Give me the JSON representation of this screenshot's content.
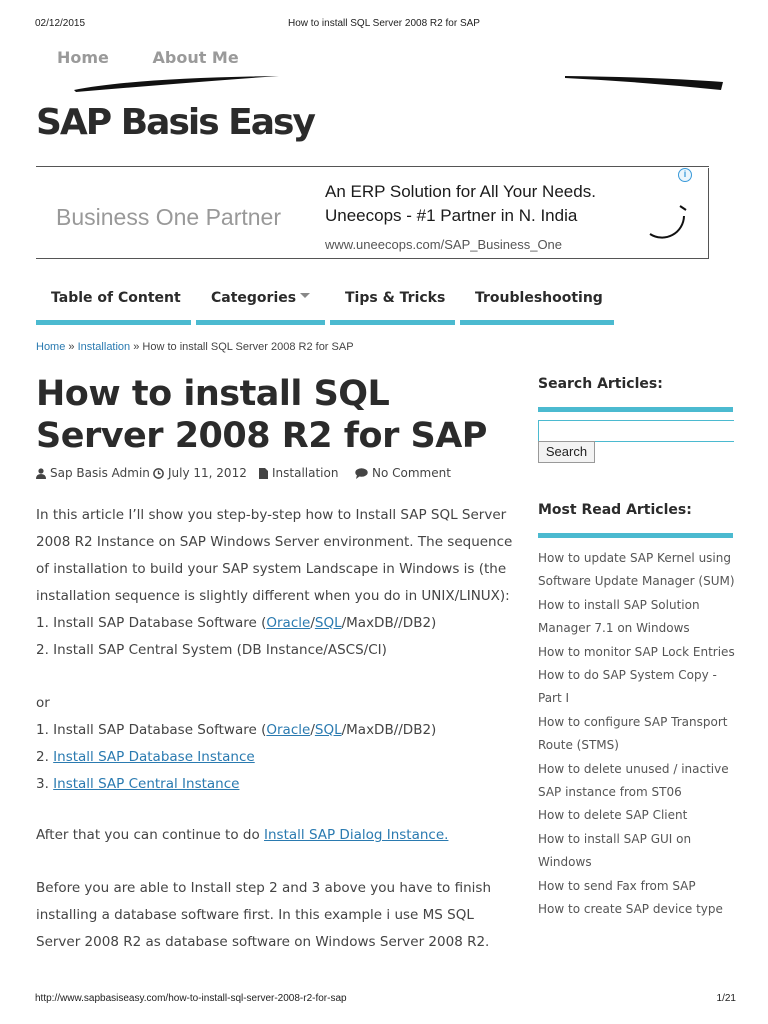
{
  "print": {
    "date": "02/12/2015",
    "doc_title": "How to install SQL Server 2008 R2 for SAP",
    "footer_url": "http://www.sapbasiseasy.com/how-to-install-sql-server-2008-r2-for-sap",
    "page": "1/21"
  },
  "topnav": {
    "home": "Home",
    "about": "About Me"
  },
  "site": {
    "title": "SAP Basis Easy"
  },
  "ad": {
    "brand": "Business One Partner",
    "headline_1": "An ERP Solution for All Your Needs.",
    "headline_2": "Uneecops - #1 Partner in N. India",
    "url": "www.uneecops.com/SAP_Business_One",
    "info_icon": "i"
  },
  "catnav": {
    "items": [
      "Table of Content",
      "Categories",
      "Tips & Tricks",
      "Troubleshooting"
    ]
  },
  "breadcrumb": {
    "home": "Home",
    "sep": " » ",
    "category": "Installation",
    "current": "How to install SQL Server 2008 R2 for SAP"
  },
  "article": {
    "title": "How to install SQL Server 2008 R2 for SAP",
    "author": "Sap Basis Admin",
    "date": "July 11, 2012",
    "category": "Installation",
    "comments": "No Comment",
    "intro_lines": [
      "In this article I’ll show you step-by-step how to Install SAP SQL Server",
      "2008 R2 Instance on SAP Windows Server environment. The sequence",
      "of installation to build your SAP system Landscape in Windows is (the",
      "installation sequence is slightly different when you do in UNIX/LINUX):"
    ],
    "step1a_prefix": "1. Install SAP Database Software (",
    "link_oracle": "Oracle",
    "slash": "/",
    "link_sql": "SQL",
    "step1a_suffix": "/MaxDB//DB2)",
    "step2a": "2. Install SAP Central System (DB Instance/ASCS/CI)",
    "or": "or",
    "step2b_prefix": "2. ",
    "step2b_link": "Install SAP Database Instance",
    "step3b_prefix": "3. ",
    "step3b_link": "Install SAP Central Instance",
    "after_prefix": "After that you can continue to do ",
    "after_link": "Install SAP Dialog Instance.",
    "before_lines": [
      "Before you are able to Install step 2 and 3 above you have to finish",
      "installing a database software first. In this example i use MS SQL",
      "Server 2008 R2 as database software on Windows Server 2008 R2."
    ]
  },
  "sidebar": {
    "search_heading": "Search Articles:",
    "search_button": "Search",
    "most_read_heading": "Most Read Articles:",
    "most_read": [
      [
        "How to update SAP Kernel using",
        "Software Update Manager (SUM)"
      ],
      [
        "How to install SAP Solution",
        "Manager 7.1 on Windows"
      ],
      [
        "How to monitor SAP Lock Entries"
      ],
      [
        "How to do SAP System Copy -",
        "Part I"
      ],
      [
        "How to configure SAP Transport",
        "Route (STMS)"
      ],
      [
        "How to delete unused / inactive",
        "SAP instance from ST06"
      ],
      [
        "How to delete SAP Client"
      ],
      [
        "How to install SAP GUI on",
        "Windows"
      ],
      [
        "How to send Fax from SAP"
      ],
      [
        "How to create SAP device type"
      ]
    ]
  },
  "colors": {
    "accent": "#4bbad0",
    "link": "#2a7ab0",
    "title": "#2b2b2b"
  }
}
